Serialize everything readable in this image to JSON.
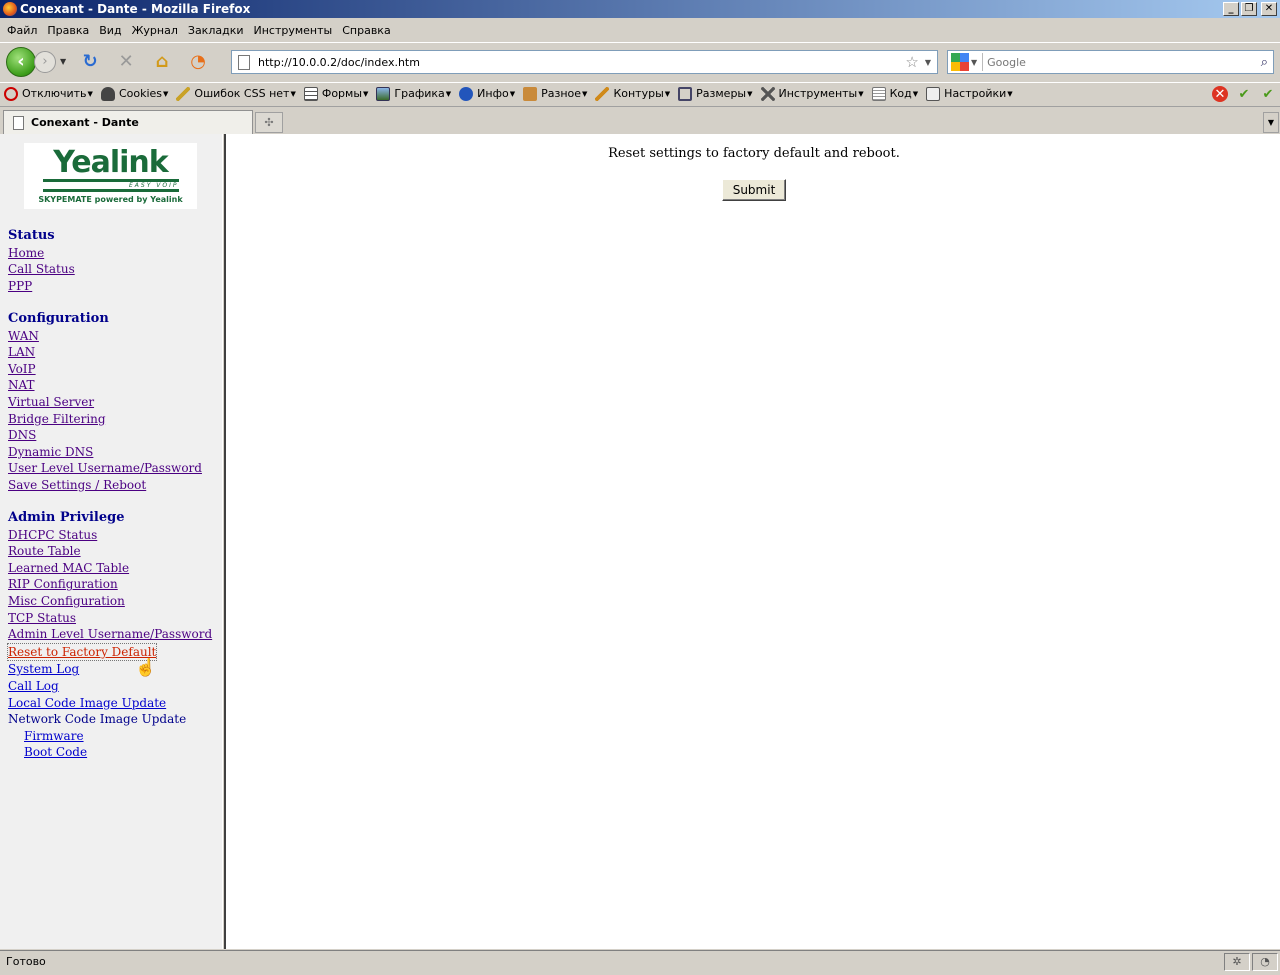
{
  "window": {
    "title": "Conexant - Dante - Mozilla Firefox",
    "minimize": "_",
    "maximize": "❐",
    "close": "✕"
  },
  "menubar": {
    "items": [
      "Файл",
      "Правка",
      "Вид",
      "Журнал",
      "Закладки",
      "Инструменты",
      "Справка"
    ]
  },
  "navbar": {
    "url": "http://10.0.0.2/doc/index.htm",
    "search_placeholder": "Google"
  },
  "devbar": {
    "items": [
      "Отключить",
      "Cookies",
      "Ошибок CSS нет",
      "Формы",
      "Графика",
      "Инфо",
      "Разное",
      "Контуры",
      "Размеры",
      "Инструменты",
      "Код",
      "Настройки"
    ]
  },
  "tabs": {
    "active": "Conexant - Dante"
  },
  "sidebar": {
    "logo": {
      "brand": "Yealink",
      "slogan": "EASY VOIP",
      "tag": "SKYPEMATE powered by Yealink"
    },
    "status_header": "Status",
    "status_links": [
      "Home",
      "Call Status",
      "PPP"
    ],
    "config_header": "Configuration",
    "config_links": [
      "WAN",
      "LAN",
      "VoIP",
      "NAT",
      "Virtual Server",
      "Bridge Filtering",
      "DNS",
      "Dynamic DNS",
      "User Level Username/Password",
      "Save Settings / Reboot"
    ],
    "admin_header": "Admin Privilege",
    "admin_links": [
      "DHCPC Status",
      "Route Table",
      "Learned MAC Table",
      "RIP Configuration",
      "Misc Configuration",
      "TCP Status",
      "Admin Level Username/Password",
      "Reset to Factory Default",
      "System Log",
      "Call Log",
      "Local Code Image Update"
    ],
    "network_update": "Network Code Image Update",
    "network_sub": [
      "Firmware",
      "Boot Code"
    ]
  },
  "main": {
    "message": "Reset settings to factory default and reboot.",
    "submit_label": "Submit"
  },
  "statusbar": {
    "text": "Готово"
  }
}
